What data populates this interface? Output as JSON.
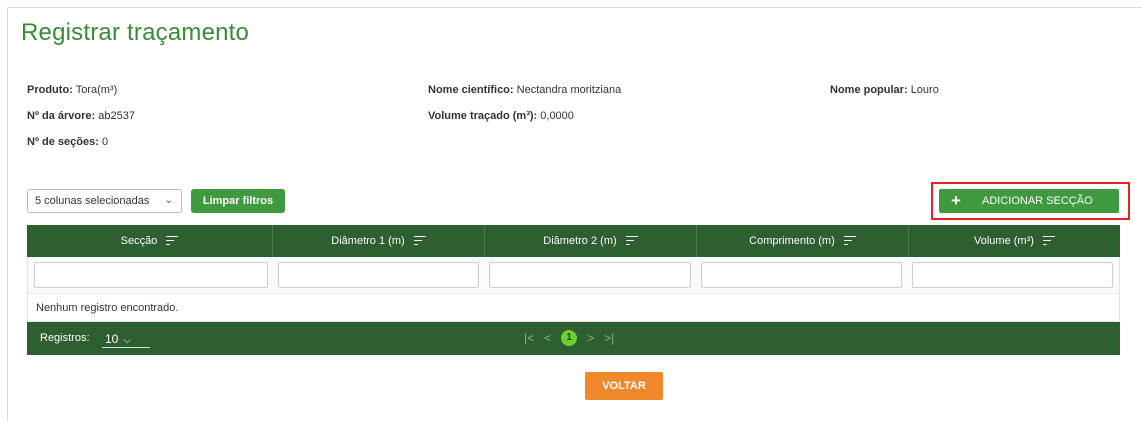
{
  "page": {
    "title": "Registrar traçamento"
  },
  "info": {
    "produto_label": "Produto:",
    "produto_value": "Tora(m³)",
    "nome_cientifico_label": "Nome científico:",
    "nome_cientifico_value": "Nectandra moritziana",
    "nome_popular_label": "Nome popular:",
    "nome_popular_value": "Louro",
    "arvore_label": "Nº da árvore:",
    "arvore_value": "ab2537",
    "volume_label": "Volume traçado (m³):",
    "volume_value": "0,0000",
    "secoes_label": "Nº de seções:",
    "secoes_value": "0"
  },
  "toolbar": {
    "columns_select": "5 colunas selecionadas",
    "clear_filters": "Limpar filtros",
    "add_section": "ADICIONAR SECÇÃO"
  },
  "grid": {
    "columns": [
      "Secção",
      "Diâmetro 1 (m)",
      "Diâmetro 2 (m)",
      "Comprimento (m)",
      "Volume (m³)"
    ],
    "empty_message": "Nenhum registro encontrado.",
    "footer": {
      "records_label": "Registros:",
      "page_size": "10",
      "current_page": "1"
    }
  },
  "actions": {
    "back": "VOLTAR"
  },
  "colors": {
    "green_header": "#2e5f30",
    "green_button": "#3f9a3f",
    "orange": "#f0882c",
    "highlight": "#e02424"
  },
  "icons": [
    "plus-icon",
    "filter-icon",
    "chevron-down-icon",
    "first-page-icon",
    "prev-page-icon",
    "next-page-icon",
    "last-page-icon"
  ]
}
